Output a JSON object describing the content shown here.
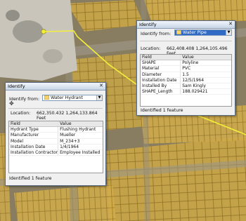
{
  "dialog_pipe": {
    "title": "Identify",
    "identify_from_label": "Identify from:",
    "layer": "Water Pipe",
    "location_label": "Location:",
    "location_value": "662,408.408  1,264,105.496 Feet",
    "columns": [
      "Field",
      "Value"
    ],
    "rows": [
      {
        "field": "SHAPE",
        "value": "Polyline"
      },
      {
        "field": "Material",
        "value": "PVC"
      },
      {
        "field": "Diameter",
        "value": "1.5"
      },
      {
        "field": "Installation Date",
        "value": "12/5/1964"
      },
      {
        "field": "Installed By",
        "value": "Sam Kingly"
      },
      {
        "field": "SHAPE_Length",
        "value": "188.029421"
      }
    ],
    "status": "Identified 1 feature"
  },
  "dialog_hydrant": {
    "title": "Identify",
    "identify_from_label": "Identify from:",
    "layer": "Water Hydrant",
    "location_label": "Location:",
    "location_value": "662,350.432  1,264,133.864 Feet",
    "columns": [
      "Field",
      "Value"
    ],
    "rows": [
      {
        "field": "Hydrant Type",
        "value": "Flushing Hydrant"
      },
      {
        "field": "Manufacturer",
        "value": "Mueller"
      },
      {
        "field": "Model",
        "value": "M_234+3"
      },
      {
        "field": "Installation Date",
        "value": "1/4/1964"
      },
      {
        "field": "Installation Contractor",
        "value": "Employee Installed"
      }
    ],
    "status": "Identified 1 feature"
  },
  "icons": {
    "close": "close-icon",
    "layer": "layer-icon",
    "dropdown": "chevron-down-icon",
    "cursor": "move-cursor-icon"
  },
  "colors": {
    "selected_pipe": "#f4ef3a",
    "parcel_lines": "#c39a33",
    "selection_blue": "#316ac5"
  }
}
